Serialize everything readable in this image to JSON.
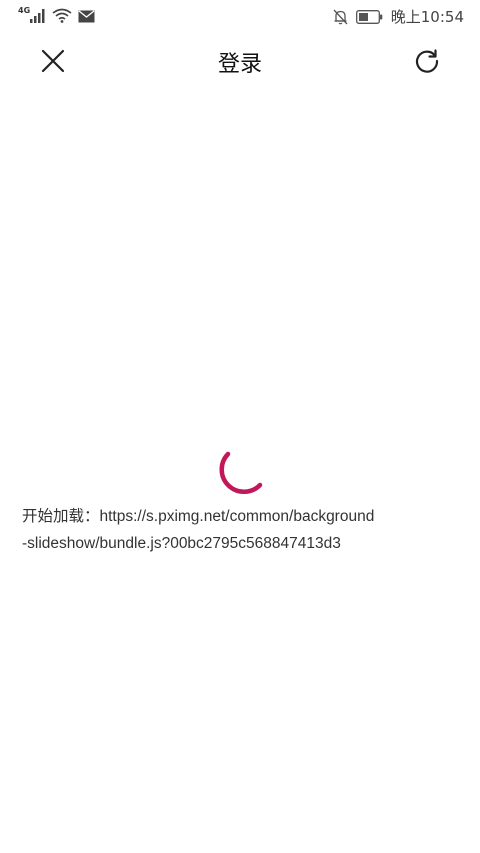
{
  "status_bar": {
    "network_type": "4G",
    "time": "晚上10:54",
    "icons": [
      "signal-icon",
      "wifi-icon",
      "mail-icon",
      "bell-off-icon",
      "battery-icon"
    ]
  },
  "toolbar": {
    "title": "登录",
    "close_icon": "close-icon",
    "refresh_icon": "refresh-icon"
  },
  "loading": {
    "spinner_color": "#c2185b",
    "message_line1": "开始加载：https://s.pximg.net/common/background",
    "message_line2": "-slideshow/bundle.js?00bc2795c568847413d3"
  }
}
